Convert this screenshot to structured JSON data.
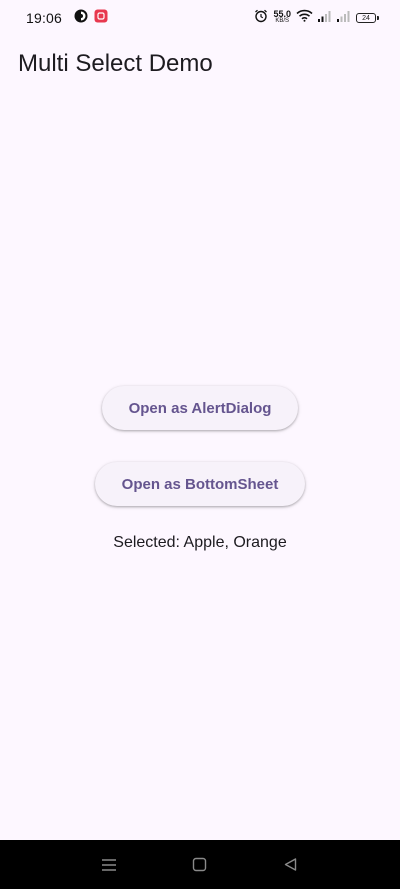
{
  "status_bar": {
    "time": "19:06",
    "net_speed_value": "55.0",
    "net_speed_unit": "KB/S",
    "battery_level": "24",
    "icons": [
      "app-notification-icon",
      "app-notification-red-icon",
      "alarm-icon",
      "wifi-icon",
      "signal-icon",
      "signal-icon",
      "battery-icon"
    ]
  },
  "app_bar": {
    "title": "Multi Select Demo"
  },
  "main": {
    "alert_dialog_button": "Open as AlertDialog",
    "bottom_sheet_button": "Open as BottomSheet",
    "selected_text": "Selected: Apple, Orange"
  },
  "nav_bar": {
    "icons": [
      "menu-icon",
      "home-square-icon",
      "back-triangle-icon"
    ]
  },
  "colors": {
    "background": "#fdf7ff",
    "button_bg": "#f7f2fa",
    "button_text": "#65558f",
    "text": "#1d1b20",
    "notification_red": "#e8384f"
  }
}
